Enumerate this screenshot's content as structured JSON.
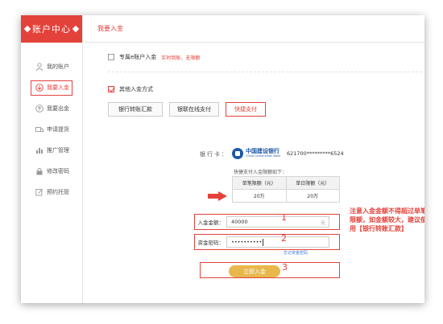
{
  "sidebar": {
    "title": "账户中心",
    "items": [
      {
        "label": "我的账户",
        "icon": "user-icon"
      },
      {
        "label": "我要入金",
        "icon": "arrow-down-circle-icon",
        "active": true
      },
      {
        "label": "我要出金",
        "icon": "arrow-up-circle-icon"
      },
      {
        "label": "申请提货",
        "icon": "truck-icon"
      },
      {
        "label": "推广管理",
        "icon": "chart-icon"
      },
      {
        "label": "修改密码",
        "icon": "lock-icon"
      },
      {
        "label": "预约托管",
        "icon": "edit-icon"
      }
    ]
  },
  "header": {
    "tab": "我要入金"
  },
  "options": {
    "exclusive_label": "专属e账户入金",
    "exclusive_note": "实时到账，无限额",
    "other_label": "其他入金方式"
  },
  "payment_methods": [
    "银行转账汇款",
    "银联在线支付",
    "快捷支付"
  ],
  "bank": {
    "card_label": "银行卡：",
    "name_cn": "中国建设银行",
    "name_en": "China Construction Bank",
    "card_number": "621700*********6524"
  },
  "limits": {
    "caption": "快捷支付入金限额如下：",
    "headers": [
      "单笔限额（元）",
      "单日限额（元）"
    ],
    "values": [
      "20万",
      "20万"
    ]
  },
  "form": {
    "amount_label": "入金金额：",
    "amount_value": "40000",
    "amount_unit": "元",
    "password_label": "资金密码：",
    "password_value": "••••••••••",
    "forgot_link": "忘记资金密码",
    "submit_label": "立即入金"
  },
  "annotations": {
    "step1": "1",
    "step2": "2",
    "step3": "3",
    "warning": "注意入金金额不得超过单笔限额，如金额较大，建议使用【银行转账汇款】"
  },
  "colors": {
    "accent": "#e3423b",
    "submit": "#e8b84d",
    "link": "#3a7bd5",
    "bank": "#1f57a4"
  }
}
